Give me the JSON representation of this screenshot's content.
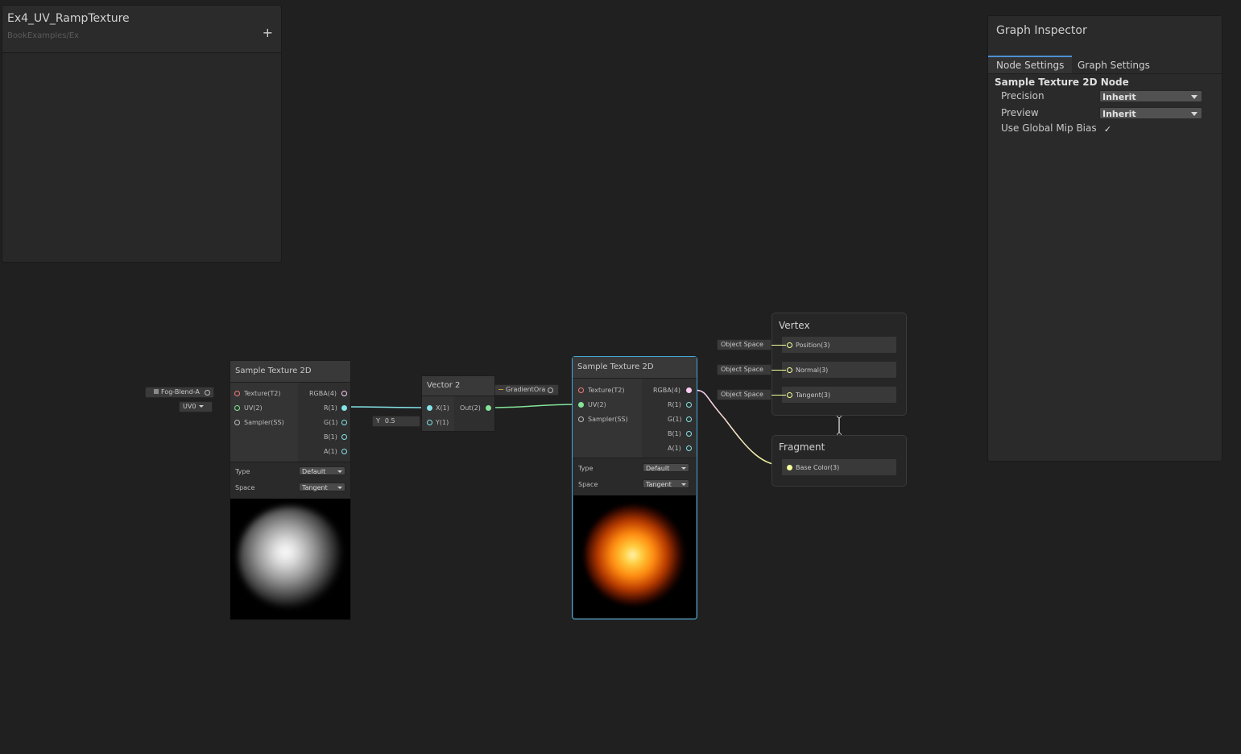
{
  "blackboard": {
    "title": "Ex4_UV_RampTexture",
    "subtitle": "BookExamples/Ex",
    "add_label": "+"
  },
  "inspector": {
    "title": "Graph Inspector",
    "tabs": [
      "Node Settings",
      "Graph Settings"
    ],
    "active_tab": 0,
    "section_title": "Sample Texture 2D Node",
    "rows": [
      {
        "label": "Precision",
        "value": "Inherit"
      },
      {
        "label": "Preview",
        "value": "Inherit"
      }
    ],
    "checkbox": {
      "label": "Use Global Mip Bias",
      "checked": true,
      "mark": "✓"
    }
  },
  "node_left": {
    "title": "Sample Texture 2D",
    "inputs": [
      "Texture(T2)",
      "UV(2)",
      "Sampler(SS)"
    ],
    "outputs": [
      "RGBA(4)",
      "R(1)",
      "G(1)",
      "B(1)",
      "A(1)"
    ],
    "type_label": "Type",
    "type_value": "Default",
    "space_label": "Space",
    "space_value": "Tangent",
    "texture_input": "Fog-Blend-A",
    "uv_input": "UV0"
  },
  "node_vector2": {
    "title": "Vector 2",
    "inputs": [
      "X(1)",
      "Y(1)"
    ],
    "output": "Out(2)",
    "y_label": "Y",
    "y_value": "0.5"
  },
  "node_right": {
    "title": "Sample Texture 2D",
    "inputs": [
      "Texture(T2)",
      "UV(2)",
      "Sampler(SS)"
    ],
    "outputs": [
      "RGBA(4)",
      "R(1)",
      "G(1)",
      "B(1)",
      "A(1)"
    ],
    "type_label": "Type",
    "type_value": "Default",
    "space_label": "Space",
    "space_value": "Tangent",
    "texture_input": "GradientOra"
  },
  "vertex": {
    "title": "Vertex",
    "slots": [
      {
        "label": "Position(3)",
        "space": "Object Space"
      },
      {
        "label": "Normal(3)",
        "space": "Object Space"
      },
      {
        "label": "Tangent(3)",
        "space": "Object Space"
      }
    ]
  },
  "fragment": {
    "title": "Fragment",
    "slots": [
      {
        "label": "Base Color(3)"
      }
    ]
  },
  "colors": {
    "texture_port": "#f07a7a",
    "uv_port": "#84e49a",
    "float_port": "#84e4e7",
    "vec3_port": "#f6ff9a",
    "vec4_port": "#fbcbf4",
    "selection": "#44a6d8"
  }
}
